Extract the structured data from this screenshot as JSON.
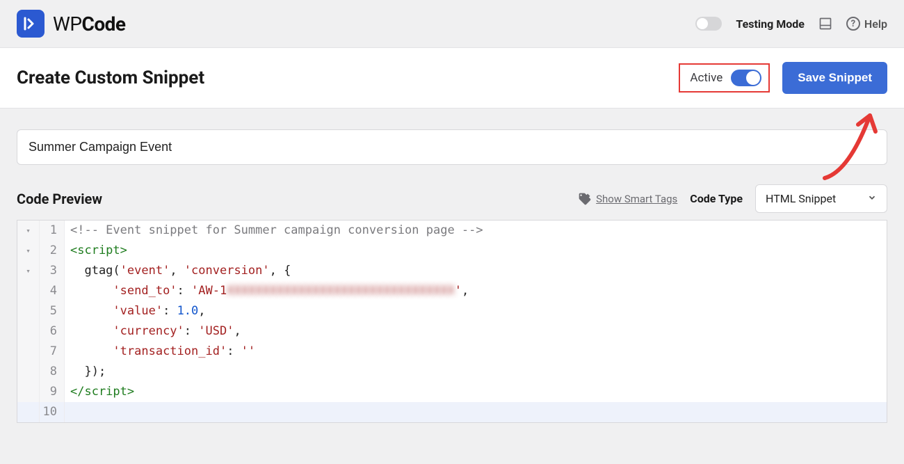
{
  "brand": {
    "name": "WPCode"
  },
  "topbar": {
    "testing_label": "Testing Mode",
    "help_label": "Help"
  },
  "header": {
    "title": "Create Custom Snippet",
    "active_label": "Active",
    "save_label": "Save Snippet"
  },
  "snippet": {
    "title_value": "Summer Campaign Event"
  },
  "preview": {
    "section_title": "Code Preview",
    "smart_tags_label": "Show Smart Tags",
    "code_type_label": "Code Type",
    "code_type_value": "HTML Snippet"
  },
  "code": {
    "lines": [
      {
        "n": 1,
        "fold": "▾"
      },
      {
        "n": 2,
        "fold": "▾"
      },
      {
        "n": 3,
        "fold": "▾"
      },
      {
        "n": 4,
        "fold": ""
      },
      {
        "n": 5,
        "fold": ""
      },
      {
        "n": 6,
        "fold": ""
      },
      {
        "n": 7,
        "fold": ""
      },
      {
        "n": 8,
        "fold": ""
      },
      {
        "n": 9,
        "fold": ""
      },
      {
        "n": 10,
        "fold": ""
      }
    ],
    "comment": "<!-- Event snippet for Summer campaign conversion page -->",
    "script_open": "<script>",
    "script_close": "</script>",
    "gtag_call_prefix": "  gtag(",
    "str_event": "'event'",
    "str_conversion": "'conversion'",
    "obj_open": ", {",
    "send_to_key": "'send_to'",
    "send_to_prefix": "'AW-1",
    "send_to_blur": "XXXXXXXXXXXXXXXXXXXXXXXXXXXXXXXX",
    "send_to_suffix": "'",
    "value_key": "'value'",
    "value_num": "1.0",
    "currency_key": "'currency'",
    "currency_val": "'USD'",
    "txn_key": "'transaction_id'",
    "txn_val": "''",
    "obj_close": "  });"
  }
}
